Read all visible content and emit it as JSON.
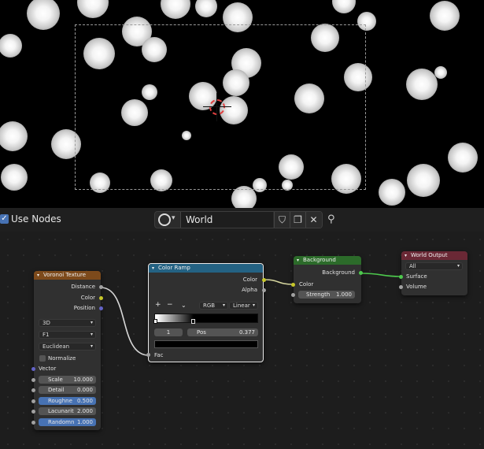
{
  "header": {
    "use_nodes_label": "Use Nodes",
    "world_name": "World",
    "use_nodes_checked": true
  },
  "nodes": {
    "voronoi": {
      "title": "Voronoi Texture",
      "outputs": [
        "Distance",
        "Color",
        "Position"
      ],
      "dimension": "3D",
      "feature": "F1",
      "metric": "Euclidean",
      "normalize_label": "Normalize",
      "vector_label": "Vector",
      "fields": [
        {
          "label": "Scale",
          "value": "10.000"
        },
        {
          "label": "Detail",
          "value": "0.000"
        },
        {
          "label": "Roughne",
          "value": "0.500"
        },
        {
          "label": "Lacunarit",
          "value": "2.000"
        },
        {
          "label": "Randomn",
          "value": "1.000"
        }
      ]
    },
    "color_ramp": {
      "title": "Color Ramp",
      "outputs": [
        "Color",
        "Alpha"
      ],
      "add": "+",
      "remove": "−",
      "color_mode": "RGB",
      "interpolation": "Linear",
      "stop_index": "1",
      "pos_label": "Pos",
      "pos_value": "0.377",
      "input_label": "Fac"
    },
    "background": {
      "title": "Background",
      "output": "Background",
      "color_label": "Color",
      "strength_label": "Strength",
      "strength_value": "1.000"
    },
    "world_output": {
      "title": "World Output",
      "target": "All",
      "surface_label": "Surface",
      "volume_label": "Volume"
    }
  },
  "colors": {
    "voronoi_header": "#7d4a1b",
    "color_ramp_header": "#246283",
    "background_header": "#2c6b2a",
    "world_output_header": "#6a2835",
    "accent": "#4772b3"
  }
}
